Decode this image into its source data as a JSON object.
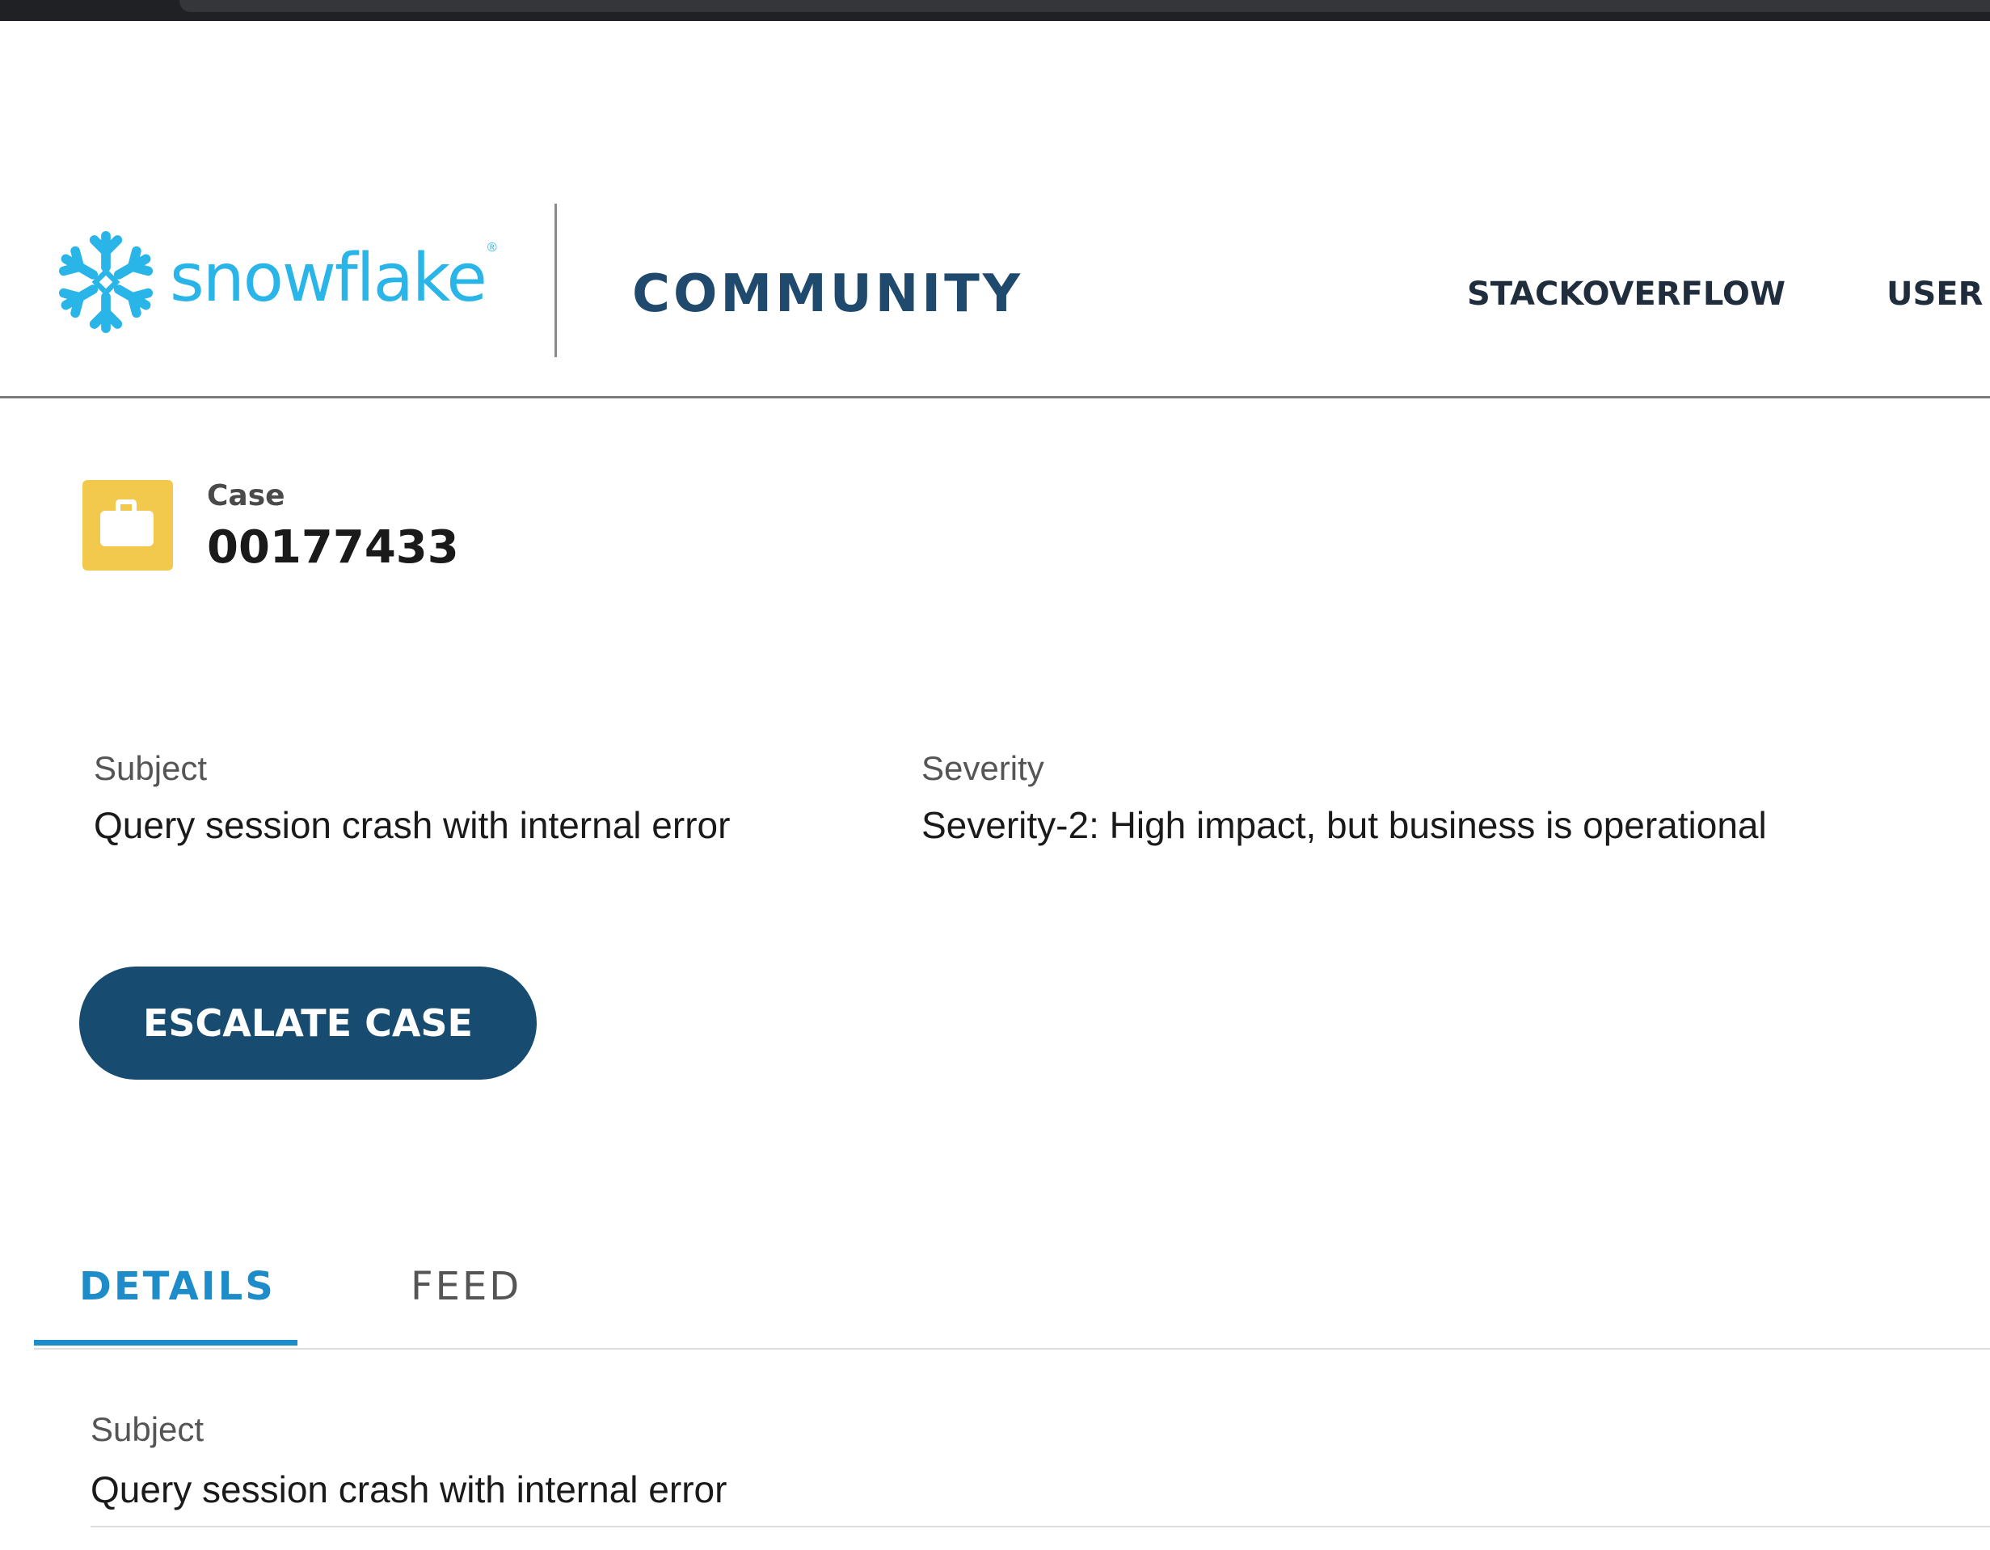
{
  "brand": {
    "logo_text": "snowflake",
    "registered_mark": "®",
    "section_title": "COMMUNITY",
    "logo_color": "#29b5e8",
    "accent_color": "#174b70"
  },
  "nav": {
    "items": [
      {
        "label": "STACKOVERFLOW"
      },
      {
        "label": "USER"
      }
    ]
  },
  "case": {
    "type_label": "Case",
    "number": "00177433",
    "icon": "briefcase-icon",
    "icon_color": "#f2c94c"
  },
  "highlights": {
    "subject_label": "Subject",
    "subject_value": "Query session crash with internal error",
    "severity_label": "Severity",
    "severity_value": "Severity-2: High impact, but business is operational"
  },
  "actions": {
    "escalate_label": "ESCALATE CASE"
  },
  "tabs": [
    {
      "label": "DETAILS",
      "active": true
    },
    {
      "label": "FEED",
      "active": false
    }
  ],
  "details": {
    "subject_label": "Subject",
    "subject_value": "Query session crash with internal error"
  }
}
